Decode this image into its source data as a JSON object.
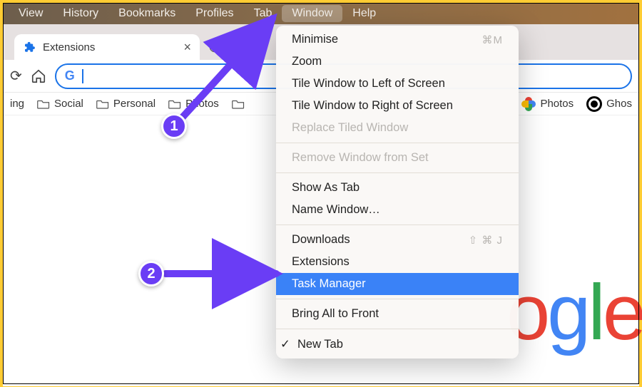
{
  "menubar": {
    "items": [
      "View",
      "History",
      "Bookmarks",
      "Profiles",
      "Tab",
      "Window",
      "Help"
    ],
    "active_index": 5
  },
  "tabs": {
    "active": {
      "title": "Extensions",
      "icon": "puzzle"
    },
    "other_prefix": "N"
  },
  "omnibox": {
    "value": ""
  },
  "bookmarks": {
    "left_cutoff": "ing",
    "items": [
      "Social",
      "Personal",
      "Photos"
    ],
    "right": [
      {
        "icon": "gphotos",
        "label": "Photos"
      },
      {
        "icon": "ghost",
        "label": "Ghos"
      }
    ]
  },
  "dropdown": {
    "sections": [
      [
        {
          "label": "Minimise",
          "shortcut": "⌘M"
        },
        {
          "label": "Zoom"
        },
        {
          "label": "Tile Window to Left of Screen"
        },
        {
          "label": "Tile Window to Right of Screen"
        },
        {
          "label": "Replace Tiled Window",
          "disabled": true
        }
      ],
      [
        {
          "label": "Remove Window from Set",
          "disabled": true
        }
      ],
      [
        {
          "label": "Show As Tab"
        },
        {
          "label": "Name Window…"
        }
      ],
      [
        {
          "label": "Downloads",
          "shortcut": "⇧ ⌘ J"
        },
        {
          "label": "Extensions"
        },
        {
          "label": "Task Manager",
          "highlight": true
        }
      ],
      [
        {
          "label": "Bring All to Front"
        }
      ],
      [
        {
          "label": "New Tab",
          "checked": true
        }
      ]
    ]
  },
  "annotations": {
    "badge1": "1",
    "badge2": "2"
  },
  "google_logo_fragment": "ogle"
}
